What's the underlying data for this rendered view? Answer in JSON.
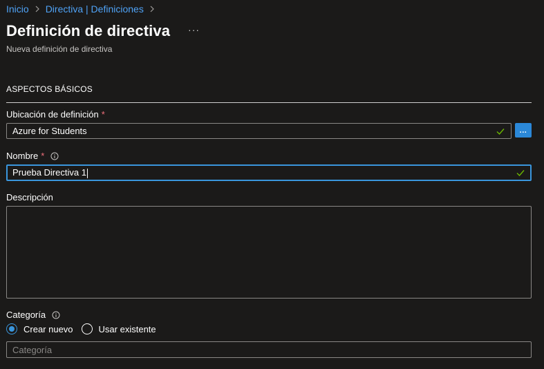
{
  "breadcrumb": {
    "items": [
      "Inicio",
      "Directiva | Definiciones"
    ]
  },
  "header": {
    "title": "Definición de directiva",
    "more_label": "···",
    "subtitle": "Nueva definición de directiva"
  },
  "section": {
    "title": "ASPECTOS BÁSICOS"
  },
  "form": {
    "location": {
      "label": "Ubicación de definición",
      "required_mark": "*",
      "value": "Azure for Students",
      "browse_label": "..."
    },
    "name": {
      "label": "Nombre",
      "required_mark": "*",
      "value": "Prueba Directiva 1"
    },
    "description": {
      "label": "Descripción",
      "value": ""
    },
    "category": {
      "label": "Categoría",
      "options": [
        "Crear nuevo",
        "Usar existente"
      ],
      "selected": "Crear nuevo",
      "placeholder": "Categoría"
    }
  },
  "colors": {
    "background": "#1b1a19",
    "accent": "#3a96dd",
    "link": "#4fa3f7",
    "required": "#f1707b",
    "valid_check": "#6bb700"
  },
  "icons": {
    "separator": "chevron-right-icon",
    "info": "info-icon",
    "valid": "checkmark-icon"
  }
}
